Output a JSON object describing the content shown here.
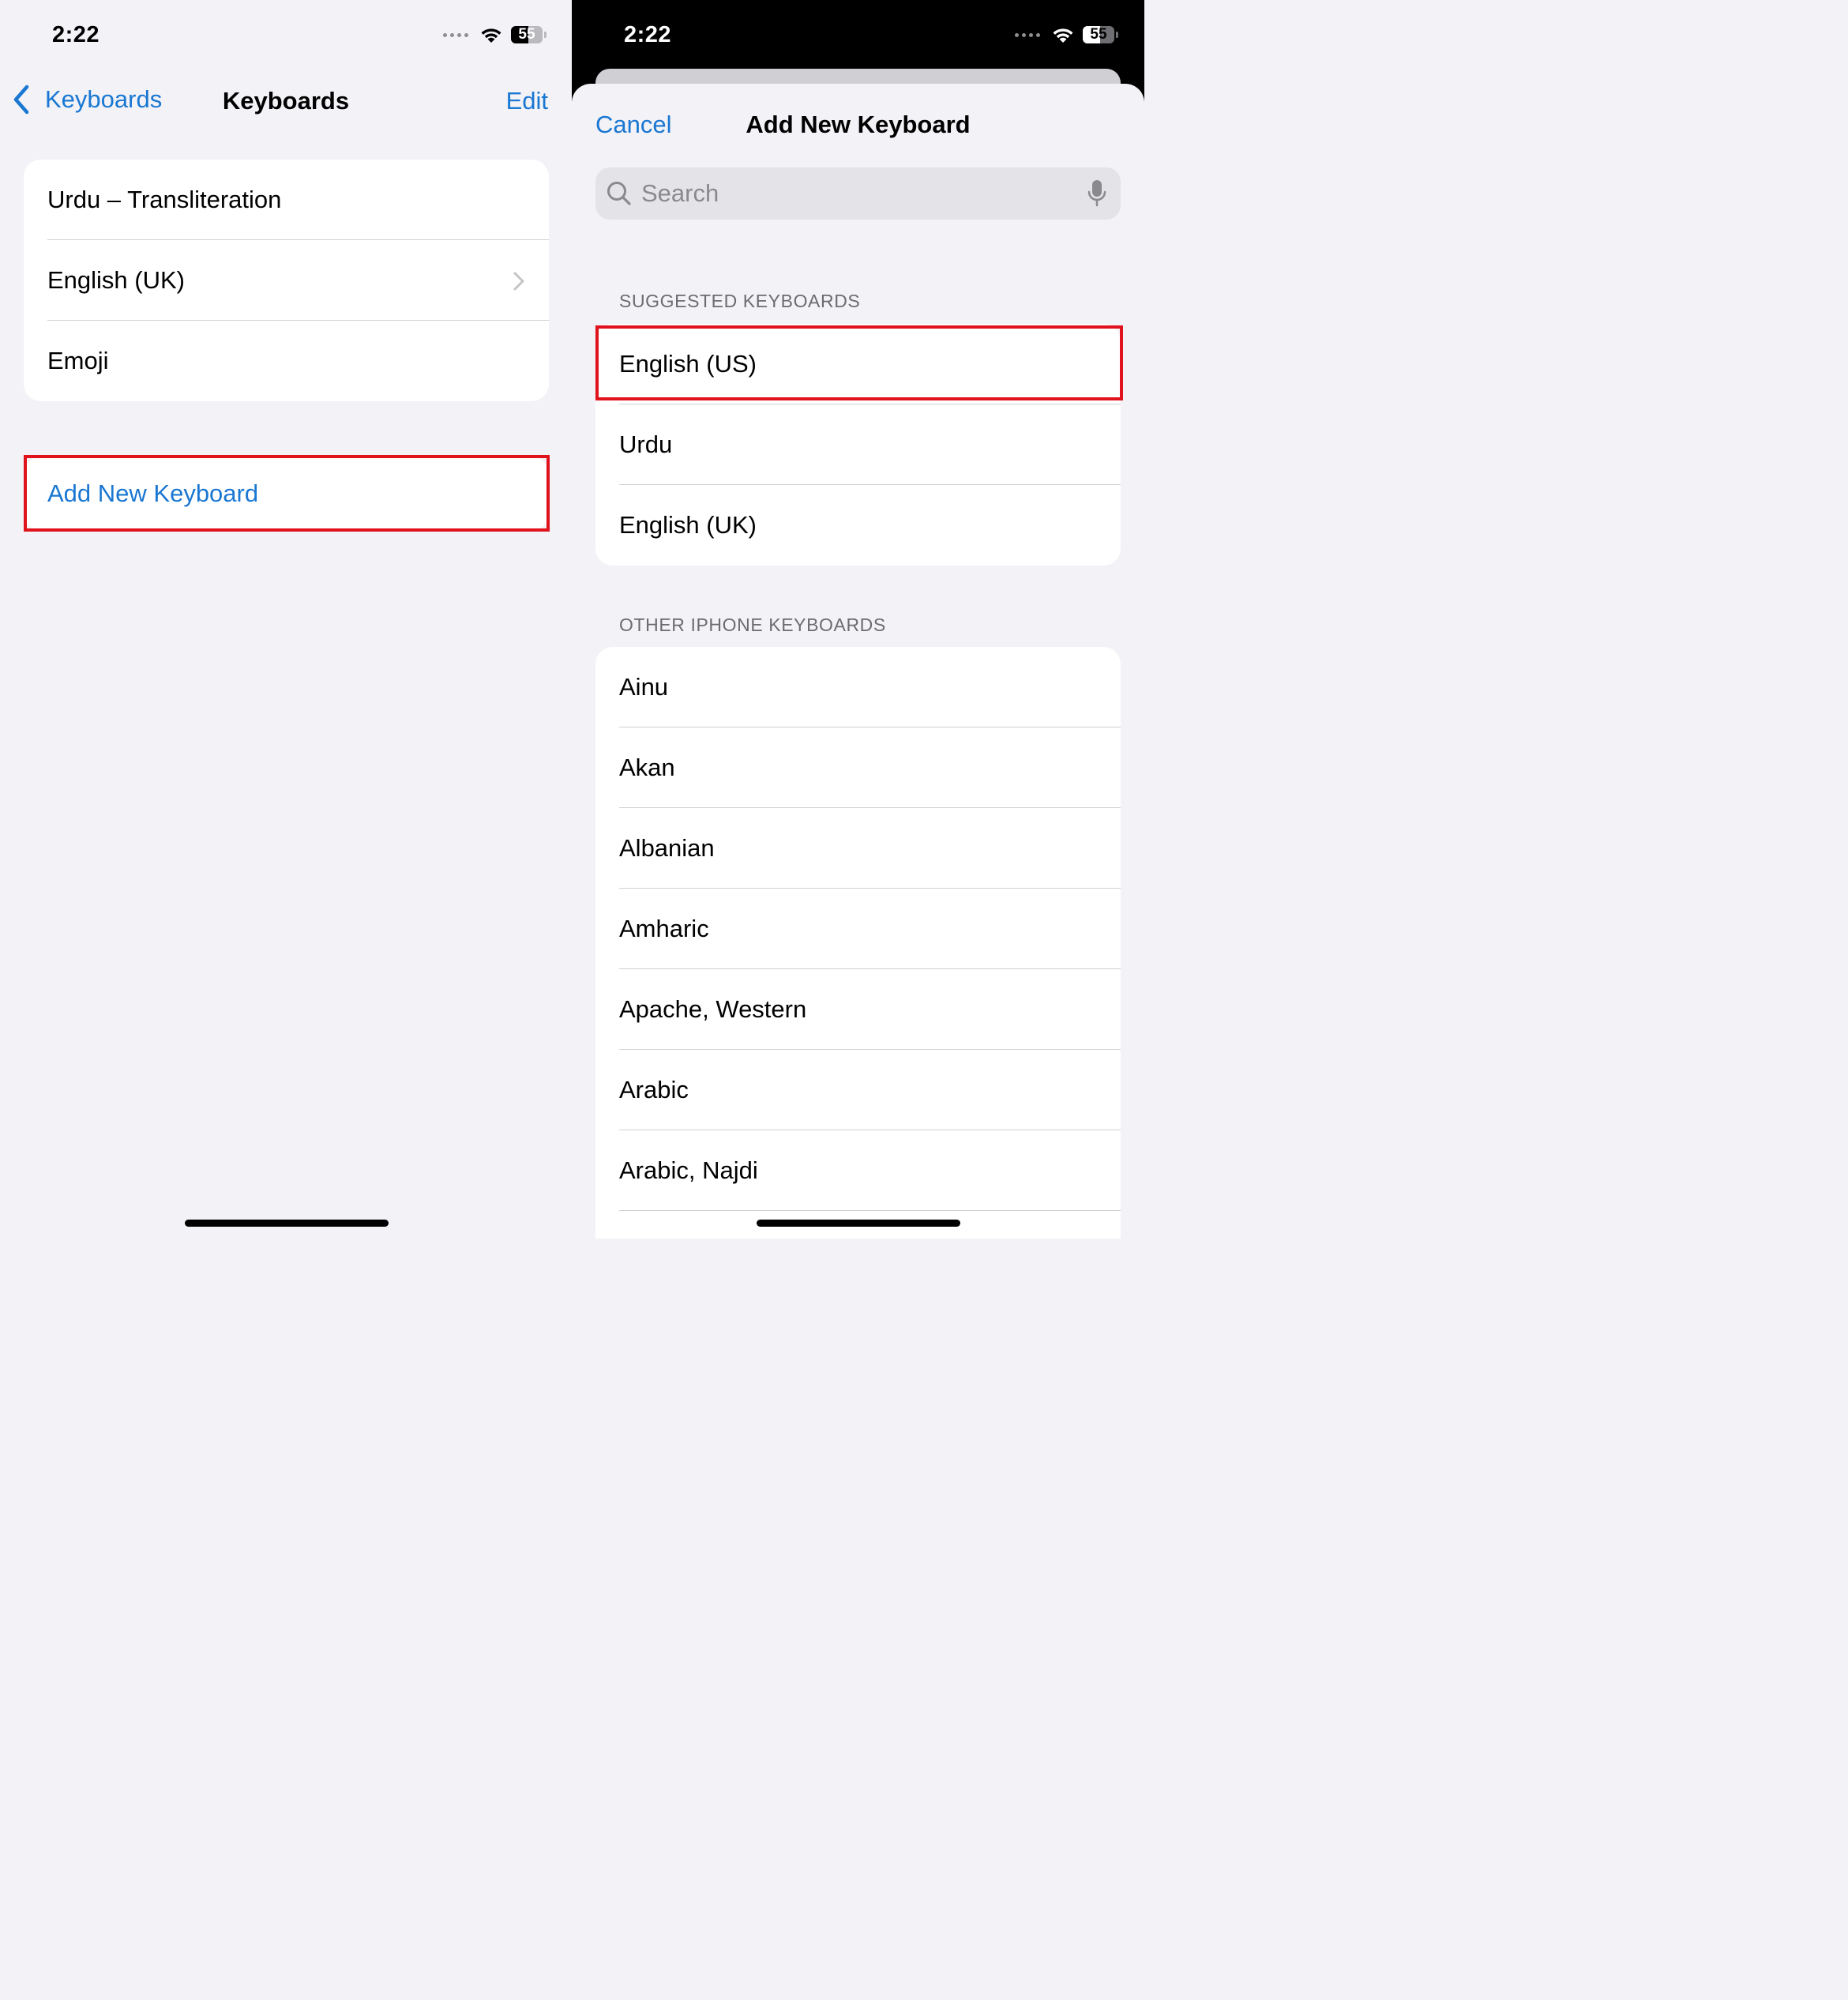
{
  "left": {
    "status": {
      "time": "2:22",
      "battery": "55"
    },
    "nav": {
      "back_label": "Keyboards",
      "title": "Keyboards",
      "edit_label": "Edit"
    },
    "keyboards": [
      {
        "label": "Urdu – Transliteration"
      },
      {
        "label": "English (UK)"
      },
      {
        "label": "Emoji"
      }
    ],
    "add_keyboard_label": "Add New Keyboard"
  },
  "right": {
    "status": {
      "time": "2:22",
      "battery": "55"
    },
    "sheet": {
      "cancel_label": "Cancel",
      "title": "Add New Keyboard",
      "search_placeholder": "Search",
      "suggested_header": "SUGGESTED KEYBOARDS",
      "suggested": [
        {
          "label": "English (US)"
        },
        {
          "label": "Urdu"
        },
        {
          "label": "English (UK)"
        }
      ],
      "other_header": "OTHER IPHONE KEYBOARDS",
      "other": [
        {
          "label": "Ainu"
        },
        {
          "label": "Akan"
        },
        {
          "label": "Albanian"
        },
        {
          "label": "Amharic"
        },
        {
          "label": "Apache, Western"
        },
        {
          "label": "Arabic"
        },
        {
          "label": "Arabic, Najdi"
        }
      ]
    }
  },
  "colors": {
    "accent": "#1a77d2",
    "highlight": "#e0121b"
  },
  "icons": [
    "wifi-icon",
    "battery-icon",
    "chevron-left-icon",
    "chevron-right-icon",
    "search-icon",
    "microphone-icon"
  ]
}
